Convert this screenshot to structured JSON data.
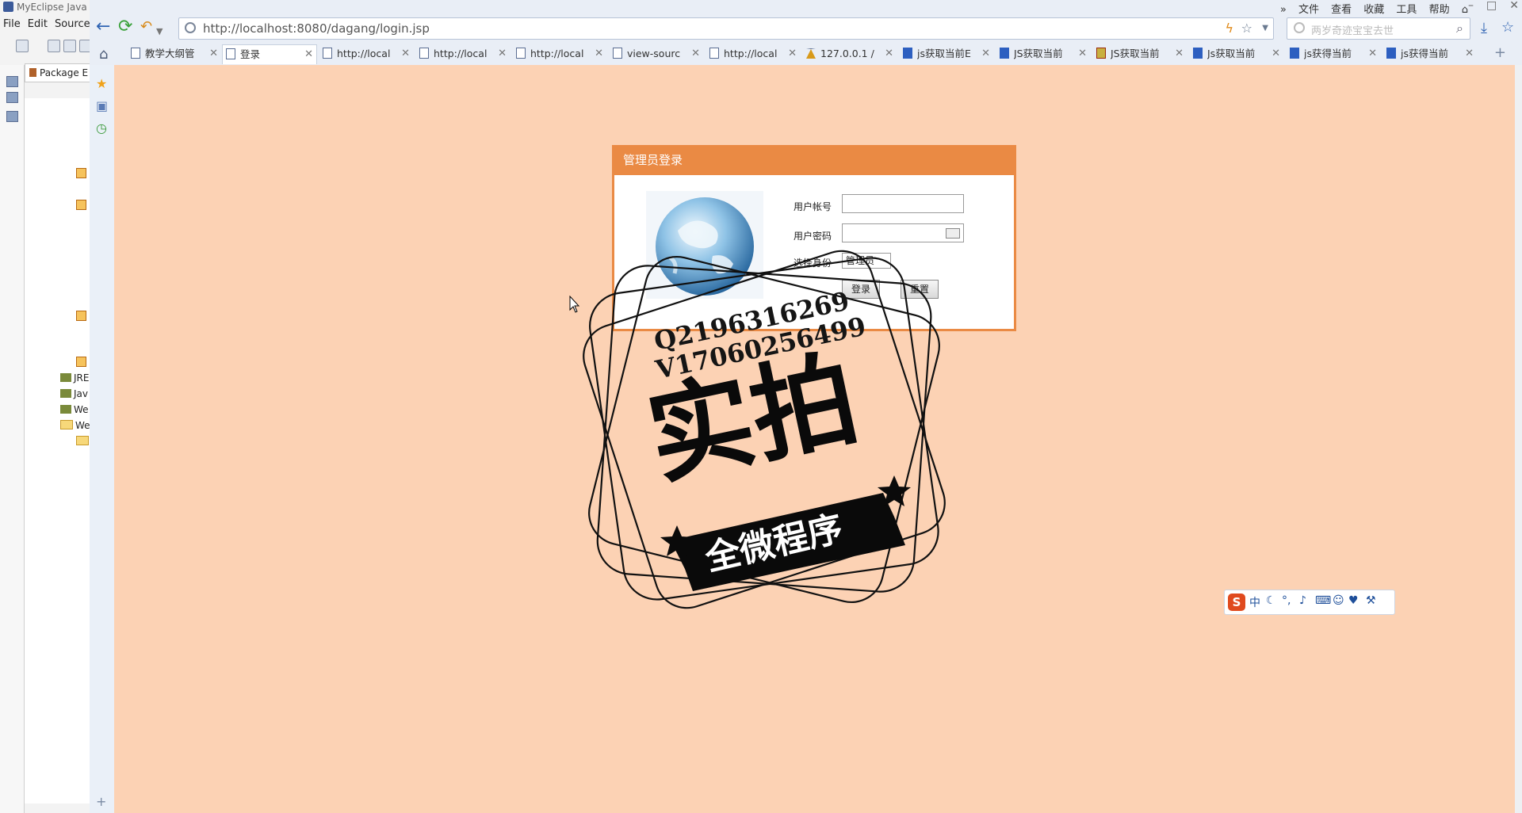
{
  "eclipse": {
    "title": "MyEclipse Java",
    "menu": [
      "File",
      "Edit",
      "Source"
    ],
    "package_tab": "Package E",
    "tree": [
      {
        "label": "JRE",
        "icon": "jar-icon"
      },
      {
        "label": "Jav",
        "icon": "jar-icon"
      },
      {
        "label": "We",
        "icon": "jar-icon"
      },
      {
        "label": "We",
        "icon": "folder-icon"
      }
    ]
  },
  "browser": {
    "top_menu": [
      "文件",
      "查看",
      "收藏",
      "工具",
      "帮助"
    ],
    "window_controls": [
      "minimize",
      "maximize",
      "close"
    ],
    "address": {
      "url": "http://localhost:8080/dagang/login.jsp"
    },
    "search": {
      "placeholder": "两岁奇迹宝宝去世"
    },
    "tabs": [
      {
        "label": "教学大纲管",
        "icon": "page-icon",
        "active": false
      },
      {
        "label": "登录",
        "icon": "page-icon",
        "active": true
      },
      {
        "label": "http://local",
        "icon": "page-icon",
        "active": false
      },
      {
        "label": "http://local",
        "icon": "page-icon",
        "active": false
      },
      {
        "label": "http://local",
        "icon": "page-icon",
        "active": false
      },
      {
        "label": "view-sourc",
        "icon": "page-icon",
        "active": false
      },
      {
        "label": "http://local",
        "icon": "page-icon",
        "active": false
      },
      {
        "label": "127.0.0.1 /",
        "icon": "warning-icon",
        "active": false
      },
      {
        "label": "js获取当前E",
        "icon": "baidu-icon",
        "active": false
      },
      {
        "label": "JS获取当前",
        "icon": "s-icon",
        "active": false
      },
      {
        "label": "JS获取当前",
        "icon": "sun-icon",
        "active": false
      },
      {
        "label": "Js获取当前",
        "icon": "s-icon",
        "active": false
      },
      {
        "label": "js获得当前",
        "icon": "baidu-icon",
        "active": false
      },
      {
        "label": "js获得当前",
        "icon": "baidu-icon",
        "active": false
      }
    ]
  },
  "login": {
    "title": "管理员登录",
    "username_label": "用户帐号",
    "username_value": "",
    "password_label": "用户密码",
    "password_value": "",
    "role_label": "选择身份",
    "role_selected": "管理员",
    "login_button": "登录",
    "reset_button": "重置"
  },
  "stamp": {
    "line1": "Q2196316269",
    "line2": "V17060256499",
    "main": "实拍",
    "ribbon": "全微程序"
  },
  "ime": {
    "mode": "中"
  },
  "colors": {
    "content_bg": "#fcd2b4",
    "login_accent": "#ea8a44",
    "browser_chrome": "#e9eef6"
  }
}
